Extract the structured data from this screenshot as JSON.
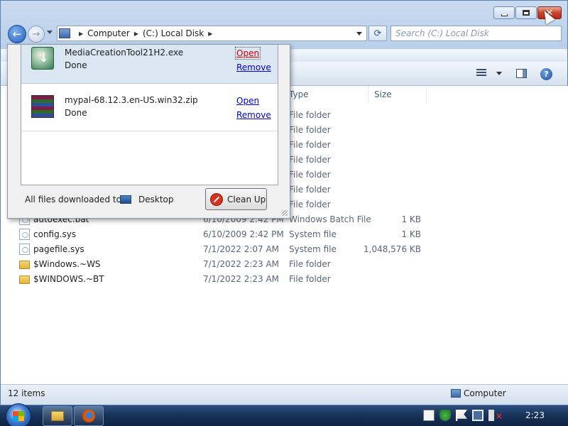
{
  "navigation": {
    "breadcrumb": [
      "Computer",
      "(C:) Local Disk"
    ],
    "search_placeholder": "Search (C:) Local Disk"
  },
  "columns": {
    "type": "Type",
    "size": "Size"
  },
  "files": [
    {
      "name": "",
      "date": "",
      "type": "File folder",
      "size": "",
      "icon": "folder-icon"
    },
    {
      "name": "",
      "date": "",
      "type": "File folder",
      "size": "",
      "icon": "folder-icon"
    },
    {
      "name": "",
      "date": "",
      "type": "File folder",
      "size": "",
      "icon": "folder-icon"
    },
    {
      "name": "",
      "date": "",
      "type": "File folder",
      "size": "",
      "icon": "folder-icon"
    },
    {
      "name": "",
      "date": "",
      "type": "File folder",
      "size": "",
      "icon": "folder-icon"
    },
    {
      "name": "",
      "date": "",
      "type": "File folder",
      "size": "",
      "icon": "folder-icon"
    },
    {
      "name": "",
      "date": "",
      "type": "File folder",
      "size": "",
      "icon": "folder-icon"
    },
    {
      "name": "autoexec.bat",
      "date": "6/10/2009 2:42 PM",
      "type": "Windows Batch File",
      "size": "1 KB",
      "icon": "batch-file-icon"
    },
    {
      "name": "config.sys",
      "date": "6/10/2009 2:42 PM",
      "type": "System file",
      "size": "1 KB",
      "icon": "system-file-icon"
    },
    {
      "name": "pagefile.sys",
      "date": "7/1/2022 2:07 AM",
      "type": "System file",
      "size": "1,048,576 KB",
      "icon": "system-file-icon"
    },
    {
      "name": "$Windows.~WS",
      "date": "7/1/2022 2:23 AM",
      "type": "File folder",
      "size": "",
      "icon": "folder-icon"
    },
    {
      "name": "$WINDOWS.~BT",
      "date": "7/1/2022 2:23 AM",
      "type": "File folder",
      "size": "",
      "icon": "folder-icon"
    }
  ],
  "status": {
    "item_count": "12 items",
    "location": "Computer"
  },
  "downloads": {
    "items": [
      {
        "name": "MediaCreationTool21H2.exe",
        "status": "Done",
        "open": "Open",
        "remove": "Remove",
        "icon": "installer-icon"
      },
      {
        "name": "mypal-68.12.3.en-US.win32.zip",
        "status": "Done",
        "open": "Open",
        "remove": "Remove",
        "icon": "archive-icon"
      }
    ],
    "footer_label": "All files downloaded to:",
    "folder": "Desktop",
    "cleanup": "Clean Up"
  },
  "taskbar": {
    "clock": "2:23"
  }
}
